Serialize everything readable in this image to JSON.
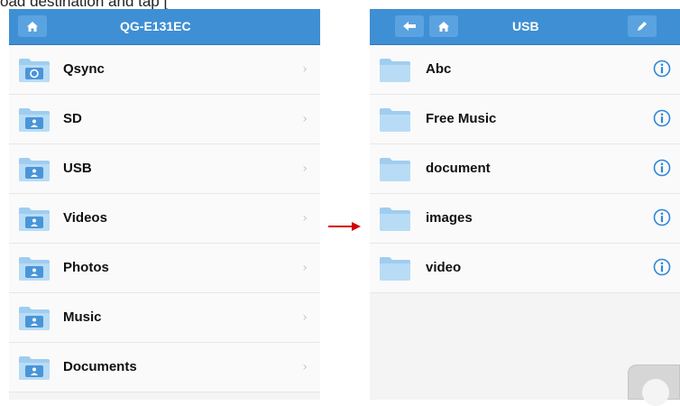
{
  "caption": "oad destination and tap [",
  "left_panel": {
    "title": "QG-E131EC",
    "items": [
      {
        "label": "Qsync",
        "icon": "sync-folder-icon"
      },
      {
        "label": "SD",
        "icon": "shared-folder-icon"
      },
      {
        "label": "USB",
        "icon": "shared-folder-icon"
      },
      {
        "label": "Videos",
        "icon": "shared-folder-icon"
      },
      {
        "label": "Photos",
        "icon": "shared-folder-icon"
      },
      {
        "label": "Music",
        "icon": "shared-folder-icon"
      },
      {
        "label": "Documents",
        "icon": "shared-folder-icon"
      }
    ]
  },
  "right_panel": {
    "title": "USB",
    "items": [
      {
        "label": "Abc"
      },
      {
        "label": "Free Music"
      },
      {
        "label": "document"
      },
      {
        "label": "images"
      },
      {
        "label": "video"
      }
    ]
  },
  "icons": {
    "home": "home-icon",
    "back": "back-arrow-icon",
    "edit": "pencil-icon",
    "chevron": "chevron-right-icon",
    "info": "info-icon",
    "pointer": "red-arrow-icon"
  },
  "colors": {
    "topbar": "#3f8fd4",
    "button": "#5aa3e0",
    "folder": "#a9d3f2",
    "info": "#2f86d8",
    "arrow": "#d40000"
  }
}
